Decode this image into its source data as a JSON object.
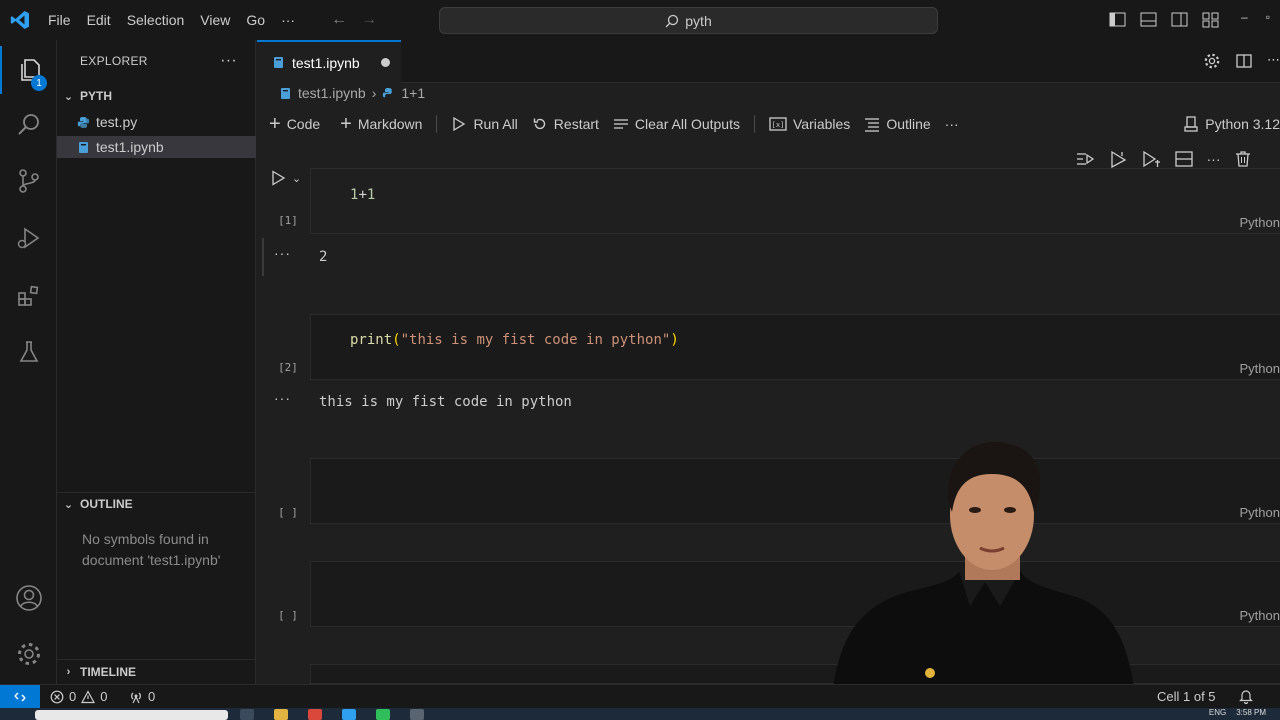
{
  "titlebar": {
    "menu": [
      "File",
      "Edit",
      "Selection",
      "View",
      "Go",
      "···"
    ],
    "search_text": "pyth"
  },
  "activity": {
    "explorer_badge": "1"
  },
  "sidebar": {
    "explorer_title": "EXPLORER",
    "more": "···",
    "folder": "PYTH",
    "files": [
      {
        "name": "test.py",
        "selected": false
      },
      {
        "name": "test1.ipynb",
        "selected": true
      }
    ],
    "outline_title": "OUTLINE",
    "outline_message": "No symbols found in document 'test1.ipynb'",
    "timeline_title": "TIMELINE"
  },
  "editor": {
    "tab_label": "test1.ipynb",
    "breadcrumb": {
      "file": "test1.ipynb",
      "sep": "›",
      "cell": "1+1"
    },
    "toolbar": {
      "code": "Code",
      "markdown": "Markdown",
      "run_all": "Run All",
      "restart": "Restart",
      "clear": "Clear All Outputs",
      "variables": "Variables",
      "outline": "Outline",
      "more": "···",
      "kernel": "Python 3.12"
    },
    "cells": [
      {
        "exec": "[1]",
        "lang": "Python",
        "output": "2"
      },
      {
        "exec": "[2]",
        "lang": "Python",
        "output": "this is my fist code in python"
      },
      {
        "exec": "[ ]",
        "lang": "Python"
      },
      {
        "exec": "[ ]",
        "lang": "Python"
      }
    ],
    "code": {
      "c1_a": "1",
      "c1_op": "+",
      "c1_b": "1",
      "c2_fn": "print",
      "c2_open": "(",
      "c2_str": "\"this is my fist code in python\"",
      "c2_close": ")"
    },
    "output_dots": "···"
  },
  "statusbar": {
    "errors": "0",
    "warnings": "0",
    "ports": "0",
    "cell_position": "Cell 1 of 5"
  },
  "taskbar": {
    "lang": "ENG",
    "time": "3:58 PM"
  },
  "colors": {
    "accent": "#0078d4",
    "bg": "#1f1f1f",
    "panel": "#181818"
  }
}
